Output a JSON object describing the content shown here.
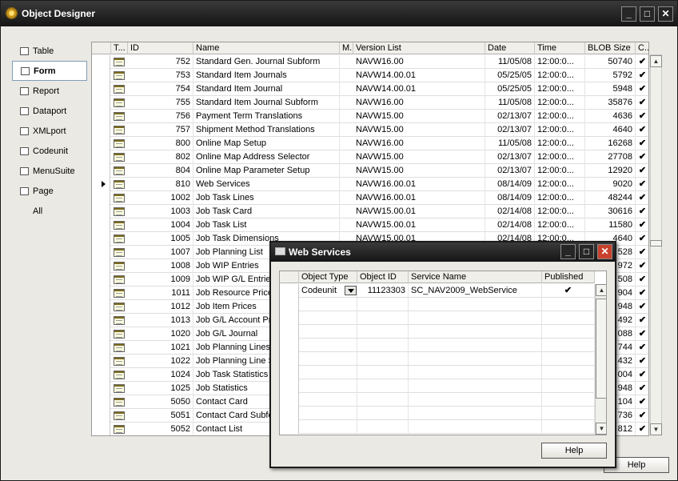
{
  "window": {
    "title": "Object Designer"
  },
  "sidebar": {
    "items": [
      {
        "label": "Table",
        "icon": "table-icon",
        "selected": false
      },
      {
        "label": "Form",
        "icon": "form-icon",
        "selected": true
      },
      {
        "label": "Report",
        "icon": "report-icon",
        "selected": false
      },
      {
        "label": "Dataport",
        "icon": "dataport-icon",
        "selected": false
      },
      {
        "label": "XMLport",
        "icon": "xmlport-icon",
        "selected": false
      },
      {
        "label": "Codeunit",
        "icon": "codeunit-icon",
        "selected": false
      },
      {
        "label": "MenuSuite",
        "icon": "menusuite-icon",
        "selected": false
      },
      {
        "label": "Page",
        "icon": "page-icon",
        "selected": false
      },
      {
        "label": "All",
        "icon": "",
        "selected": false
      }
    ]
  },
  "grid": {
    "columns": [
      "T...",
      "ID",
      "Name",
      "M...",
      "Version List",
      "Date",
      "Time",
      "BLOB Size",
      "C..."
    ],
    "rows": [
      {
        "id": "752",
        "name": "Standard Gen. Journal Subform",
        "version": "NAVW16.00",
        "date": "11/05/08",
        "time": "12:00:0...",
        "blob": "50740",
        "c": "✔"
      },
      {
        "id": "753",
        "name": "Standard Item Journals",
        "version": "NAVW14.00.01",
        "date": "05/25/05",
        "time": "12:00:0...",
        "blob": "5792",
        "c": "✔"
      },
      {
        "id": "754",
        "name": "Standard Item Journal",
        "version": "NAVW14.00.01",
        "date": "05/25/05",
        "time": "12:00:0...",
        "blob": "5948",
        "c": "✔"
      },
      {
        "id": "755",
        "name": "Standard Item Journal Subform",
        "version": "NAVW16.00",
        "date": "11/05/08",
        "time": "12:00:0...",
        "blob": "35876",
        "c": "✔"
      },
      {
        "id": "756",
        "name": "Payment Term Translations",
        "version": "NAVW15.00",
        "date": "02/13/07",
        "time": "12:00:0...",
        "blob": "4636",
        "c": "✔"
      },
      {
        "id": "757",
        "name": "Shipment Method Translations",
        "version": "NAVW15.00",
        "date": "02/13/07",
        "time": "12:00:0...",
        "blob": "4640",
        "c": "✔"
      },
      {
        "id": "800",
        "name": "Online Map Setup",
        "version": "NAVW16.00",
        "date": "11/05/08",
        "time": "12:00:0...",
        "blob": "16268",
        "c": "✔"
      },
      {
        "id": "802",
        "name": "Online Map Address Selector",
        "version": "NAVW15.00",
        "date": "02/13/07",
        "time": "12:00:0...",
        "blob": "27708",
        "c": "✔"
      },
      {
        "id": "804",
        "name": "Online Map Parameter Setup",
        "version": "NAVW15.00",
        "date": "02/13/07",
        "time": "12:00:0...",
        "blob": "12920",
        "c": "✔"
      },
      {
        "id": "810",
        "name": "Web Services",
        "version": "NAVW16.00.01",
        "date": "08/14/09",
        "time": "12:00:0...",
        "blob": "9020",
        "c": "✔",
        "current": true
      },
      {
        "id": "1002",
        "name": "Job Task Lines",
        "version": "NAVW16.00.01",
        "date": "08/14/09",
        "time": "12:00:0...",
        "blob": "48244",
        "c": "✔"
      },
      {
        "id": "1003",
        "name": "Job Task Card",
        "version": "NAVW15.00.01",
        "date": "02/14/08",
        "time": "12:00:0...",
        "blob": "30616",
        "c": "✔"
      },
      {
        "id": "1004",
        "name": "Job Task List",
        "version": "NAVW15.00.01",
        "date": "02/14/08",
        "time": "12:00:0...",
        "blob": "11580",
        "c": "✔"
      },
      {
        "id": "1005",
        "name": "Job Task Dimensions",
        "version": "NAVW15.00.01",
        "date": "02/14/08",
        "time": "12:00:0...",
        "blob": "4640",
        "c": "✔"
      },
      {
        "id": "1007",
        "name": "Job Planning List",
        "version": "",
        "date": "",
        "time": "",
        "blob": "528",
        "c": "✔"
      },
      {
        "id": "1008",
        "name": "Job WIP Entries",
        "version": "",
        "date": "",
        "time": "",
        "blob": "972",
        "c": "✔"
      },
      {
        "id": "1009",
        "name": "Job WIP G/L Entries",
        "version": "",
        "date": "",
        "time": "",
        "blob": "508",
        "c": "✔"
      },
      {
        "id": "1011",
        "name": "Job Resource Prices",
        "version": "",
        "date": "",
        "time": "",
        "blob": "904",
        "c": "✔"
      },
      {
        "id": "1012",
        "name": "Job Item Prices",
        "version": "",
        "date": "",
        "time": "",
        "blob": "948",
        "c": "✔"
      },
      {
        "id": "1013",
        "name": "Job G/L Account Pri",
        "version": "",
        "date": "",
        "time": "",
        "blob": "492",
        "c": "✔"
      },
      {
        "id": "1020",
        "name": "Job G/L Journal",
        "version": "",
        "date": "",
        "time": "",
        "blob": "088",
        "c": "✔"
      },
      {
        "id": "1021",
        "name": "Job Planning Lines",
        "version": "",
        "date": "",
        "time": "",
        "blob": "744",
        "c": "✔"
      },
      {
        "id": "1022",
        "name": "Job Planning Line S",
        "version": "",
        "date": "",
        "time": "",
        "blob": "432",
        "c": "✔"
      },
      {
        "id": "1024",
        "name": "Job Task Statistics",
        "version": "",
        "date": "",
        "time": "",
        "blob": "004",
        "c": "✔"
      },
      {
        "id": "1025",
        "name": "Job Statistics",
        "version": "",
        "date": "",
        "time": "",
        "blob": "948",
        "c": "✔"
      },
      {
        "id": "5050",
        "name": "Contact Card",
        "version": "",
        "date": "",
        "time": "",
        "blob": "104",
        "c": "✔"
      },
      {
        "id": "5051",
        "name": "Contact Card Subfo",
        "version": "",
        "date": "",
        "time": "",
        "blob": "736",
        "c": "✔"
      },
      {
        "id": "5052",
        "name": "Contact List",
        "version": "",
        "date": "",
        "time": "",
        "blob": "812",
        "c": "✔"
      }
    ]
  },
  "main": {
    "help_label": "Help"
  },
  "dialog": {
    "title": "Web Services",
    "columns": [
      "Object Type",
      "Object ID",
      "Service Name",
      "Published"
    ],
    "rows": [
      {
        "type": "Codeunit",
        "id": "11123303",
        "service": "SC_NAV2009_WebService",
        "published": "✔"
      }
    ],
    "help_label": "Help"
  }
}
